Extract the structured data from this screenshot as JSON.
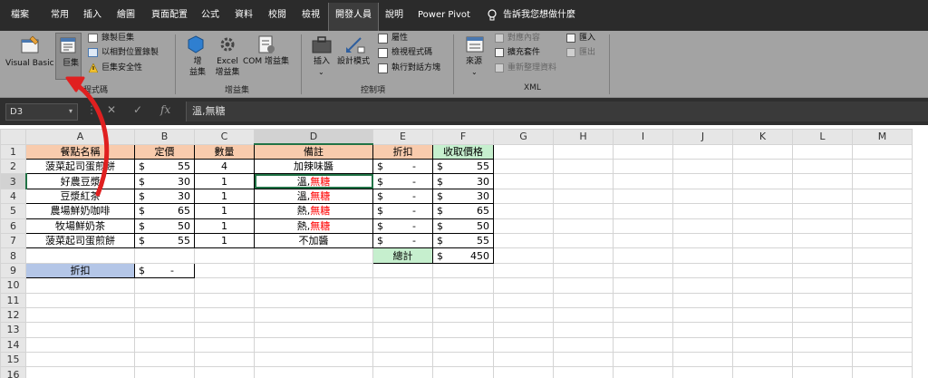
{
  "menu": {
    "tabs": [
      "檔案",
      "常用",
      "插入",
      "繪圖",
      "頁面配置",
      "公式",
      "資料",
      "校閱",
      "檢視",
      "開發人員",
      "說明",
      "Power Pivot"
    ],
    "active": "開發人員",
    "tell_me": "告訴我您想做什麼"
  },
  "ribbon": {
    "code": {
      "visual_basic": "Visual Basic",
      "macros": "巨集",
      "record": "錄製巨集",
      "relative": "以相對位置錄製",
      "security": "巨集安全性",
      "group": "程式碼"
    },
    "addins": {
      "addins": "增\n益集",
      "excel_addins": "Excel\n增益集",
      "com_addins": "COM 增益集",
      "group": "增益集"
    },
    "controls": {
      "insert": "插入",
      "design_mode": "設計模式",
      "properties": "屬性",
      "view_code": "檢視程式碼",
      "run_dialog": "執行對話方塊",
      "group": "控制項"
    },
    "xml": {
      "source": "來源",
      "map_props": "對應內容",
      "expansion": "擴充套件",
      "refresh": "重新整理資料",
      "import": "匯入",
      "export": "匯出",
      "group": "XML"
    }
  },
  "formula_bar": {
    "name_box": "D3",
    "fx": "fx",
    "value": "溫,無糖"
  },
  "columns": [
    "A",
    "B",
    "C",
    "D",
    "E",
    "F",
    "G",
    "H",
    "I",
    "J",
    "K",
    "L",
    "M"
  ],
  "rows": [
    "1",
    "2",
    "3",
    "4",
    "5",
    "6",
    "7",
    "8",
    "9",
    "10",
    "11",
    "12",
    "13",
    "14",
    "15",
    "16"
  ],
  "table": {
    "headers": {
      "name": "餐點名稱",
      "price": "定價",
      "qty": "數量",
      "note": "備註",
      "discount": "折扣",
      "received": "收取價格"
    },
    "items": [
      {
        "name": "菠菜起司蛋煎餅",
        "price": "55",
        "qty": "4",
        "note_a": "加辣味醬",
        "note_b": "",
        "disc": "-",
        "recv": "55"
      },
      {
        "name": "好農豆漿",
        "price": "30",
        "qty": "1",
        "note_a": "溫,",
        "note_b": "無糖",
        "disc": "-",
        "recv": "30"
      },
      {
        "name": "豆漿紅茶",
        "price": "30",
        "qty": "1",
        "note_a": "溫,",
        "note_b": "無糖",
        "disc": "-",
        "recv": "30"
      },
      {
        "name": "農場鮮奶咖啡",
        "price": "65",
        "qty": "1",
        "note_a": "熱,",
        "note_b": "無糖",
        "disc": "-",
        "recv": "65"
      },
      {
        "name": "牧場鮮奶茶",
        "price": "50",
        "qty": "1",
        "note_a": "熱,",
        "note_b": "無糖",
        "disc": "-",
        "recv": "50"
      },
      {
        "name": "菠菜起司蛋煎餅",
        "price": "55",
        "qty": "1",
        "note_a": "不加醬",
        "note_b": "",
        "disc": "-",
        "recv": "55"
      }
    ],
    "currency": "$",
    "total_label": "總計",
    "total_value": "450",
    "discount_label": "折扣",
    "discount_value": "-"
  },
  "colors": {
    "header_peach": "#f8cbad",
    "header_green": "#c6efce",
    "discount_blue": "#b4c6e7",
    "arrow_red": "#e02020",
    "selection_green": "#217346"
  }
}
